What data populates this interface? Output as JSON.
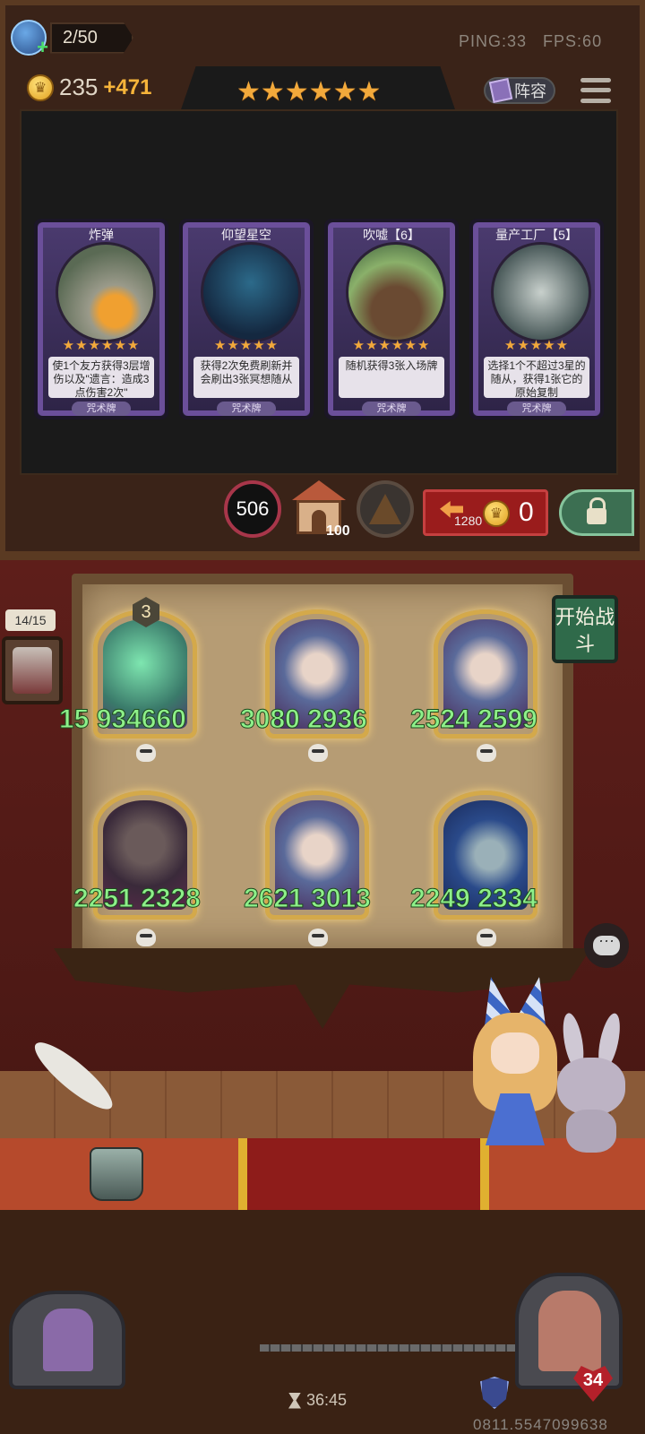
{
  "top": {
    "player_count": "2/50",
    "gold": "235",
    "gold_income": "+471",
    "ping": "PING:33",
    "fps": "FPS:60",
    "lineup_label": "阵容",
    "tier_stars": "★★★★★★"
  },
  "shop_cards": [
    {
      "title": "炸弹",
      "stars": "★★★★★★",
      "desc": "使1个友方获得3层增伤以及\"遗言：造成3点伤害2次\"",
      "type": "咒术牌"
    },
    {
      "title": "仰望星空",
      "stars": "★★★★★",
      "desc": "获得2次免费刷新并会刷出3张冥想随从",
      "type": "咒术牌"
    },
    {
      "title": "吹嘘【6】",
      "stars": "★★★★★★",
      "desc": "随机获得3张入场牌",
      "type": "咒术牌"
    },
    {
      "title": "量产工厂【5】",
      "stars": "★★★★★",
      "desc": "选择1个不超过3星的随从，获得1张它的原始复制",
      "type": "咒术牌"
    }
  ],
  "shop_bar": {
    "exp": "506",
    "house_count": "100",
    "refresh_cost": "1280",
    "refresh_coin": "0"
  },
  "board": {
    "round": "14/15",
    "start_button": "开始战斗",
    "tier_badge": "3",
    "minions": [
      {
        "attack": "15",
        "extra": "934660",
        "label": "15 934660"
      },
      {
        "attack": "3080",
        "health": "2936",
        "label": "3080 2936"
      },
      {
        "attack": "2524",
        "health": "2599",
        "label": "2524 2599"
      },
      {
        "attack": "2251",
        "health": "2328",
        "label": "2251 2328"
      },
      {
        "attack": "2621",
        "health": "3013",
        "label": "2621 3013"
      },
      {
        "attack": "2249",
        "health": "2334",
        "label": "2249 2334"
      }
    ]
  },
  "bottom": {
    "timer": "36:45",
    "hp": "34",
    "uid": "0811.5547099638"
  },
  "colors": {
    "stat_green": "#8ef08a",
    "star_gold": "#f2a93b",
    "card_purple": "#6b4f9a"
  },
  "icons": [
    "player-avatar-icon",
    "coin-icon",
    "book-icon",
    "menu-icon",
    "house-icon",
    "hat-icon",
    "refresh-icon",
    "lock-icon",
    "skull-icon",
    "chat-icon",
    "hourglass-icon",
    "armor-icon",
    "heart-icon"
  ]
}
